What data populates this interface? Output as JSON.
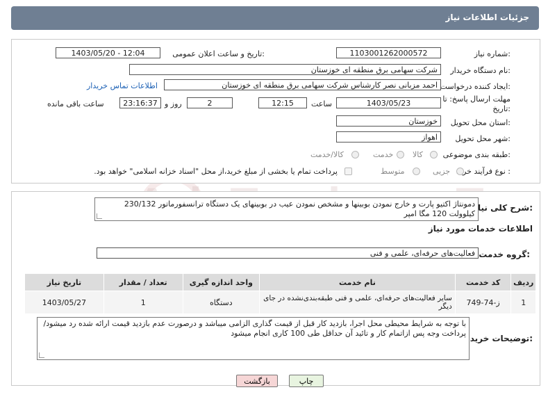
{
  "header": {
    "title": "جزئیات اطلاعات نیاز"
  },
  "fields": {
    "need_number_label": "شماره نیاز:",
    "need_number": "1103001262000572",
    "announce_label": "تاریخ و ساعت اعلان عمومی:",
    "announce_value": "1403/05/20 - 12:04",
    "buyer_org_label": "نام دستگاه خریدار:",
    "buyer_org": "شرکت سهامی برق منطقه ای خوزستان",
    "creator_label": "ایجاد کننده درخواست:",
    "creator": "احمد مزبانی نصر کارشناس شرکت سهامی برق منطقه ای خوزستان",
    "contact_link": "اطلاعات تماس خریدار",
    "deadline_label_1": "مهلت ارسال پاسخ: تا",
    "deadline_label_2": "تاریخ:",
    "deadline_date": "1403/05/23",
    "time_label": "ساعت",
    "deadline_time": "12:15",
    "days_value": "2",
    "days_label": "روز و",
    "remaining_value": "23:16:37",
    "remaining_label": "ساعت باقی مانده",
    "province_label": "استان محل تحویل:",
    "province": "خوزستان",
    "city_label": "شهر محل تحویل:",
    "city": "اهواز",
    "category_label": "طبقه بندی موضوعی:",
    "category_options": [
      "کالا",
      "خدمت",
      "کالا/خدمت"
    ],
    "process_label": "نوع فرآیند خرید :",
    "process_options": [
      "جزیی",
      "متوسط"
    ],
    "payment_note": "پرداخت تمام یا بخشی از مبلغ خرید،از محل \"اسناد خزانه اسلامی\" خواهد بود."
  },
  "summary": {
    "label": "شرح کلی نیاز:",
    "text": "دمونتاژ اکتیو پارت و خارج نمودن بوبینها و مشخص نمودن عیب در بوبینهای یک دستگاه ترانسفورماتور 230/132 کیلوولت 120 مگا امپر"
  },
  "services": {
    "section_title": "اطلاعات خدمات مورد نیاز",
    "group_label": "گروه خدمت:",
    "group_value": "فعالیت‌های حرفه‌ای، علمی و فنی",
    "columns": [
      "ردیف",
      "کد خدمت",
      "نام خدمت",
      "واحد اندازه گیری",
      "تعداد / مقدار",
      "تاریخ نیاز"
    ],
    "rows": [
      [
        "1",
        "ز-74-749",
        "سایر فعالیت‌های حرفه‌ای، علمی و فنی طبقه‌بندی‌نشده در جای دیگر",
        "دستگاه",
        "1",
        "1403/05/27"
      ]
    ]
  },
  "buyer_notes": {
    "label": "توضیحات خریدار:",
    "text": "با توجه به شرایط محیطی محل اجرا، بازدید کار قبل از قیمت گذاری الزامی میباشد و درصورت عدم بازدید قیمت ارائه شده رد میشود/ پرداخت وجه پس ازاتمام کار و تائید آن حداقل طی 100 کاری انجام میشود"
  },
  "buttons": {
    "print": "چاپ",
    "back": "بازگشت"
  },
  "watermark": "AriaTender.neT",
  "colors": {
    "header": "#6f7f93",
    "link": "#1a5fb4",
    "back_button": "#f6d6d6",
    "print_button": "#e8f4e0"
  }
}
